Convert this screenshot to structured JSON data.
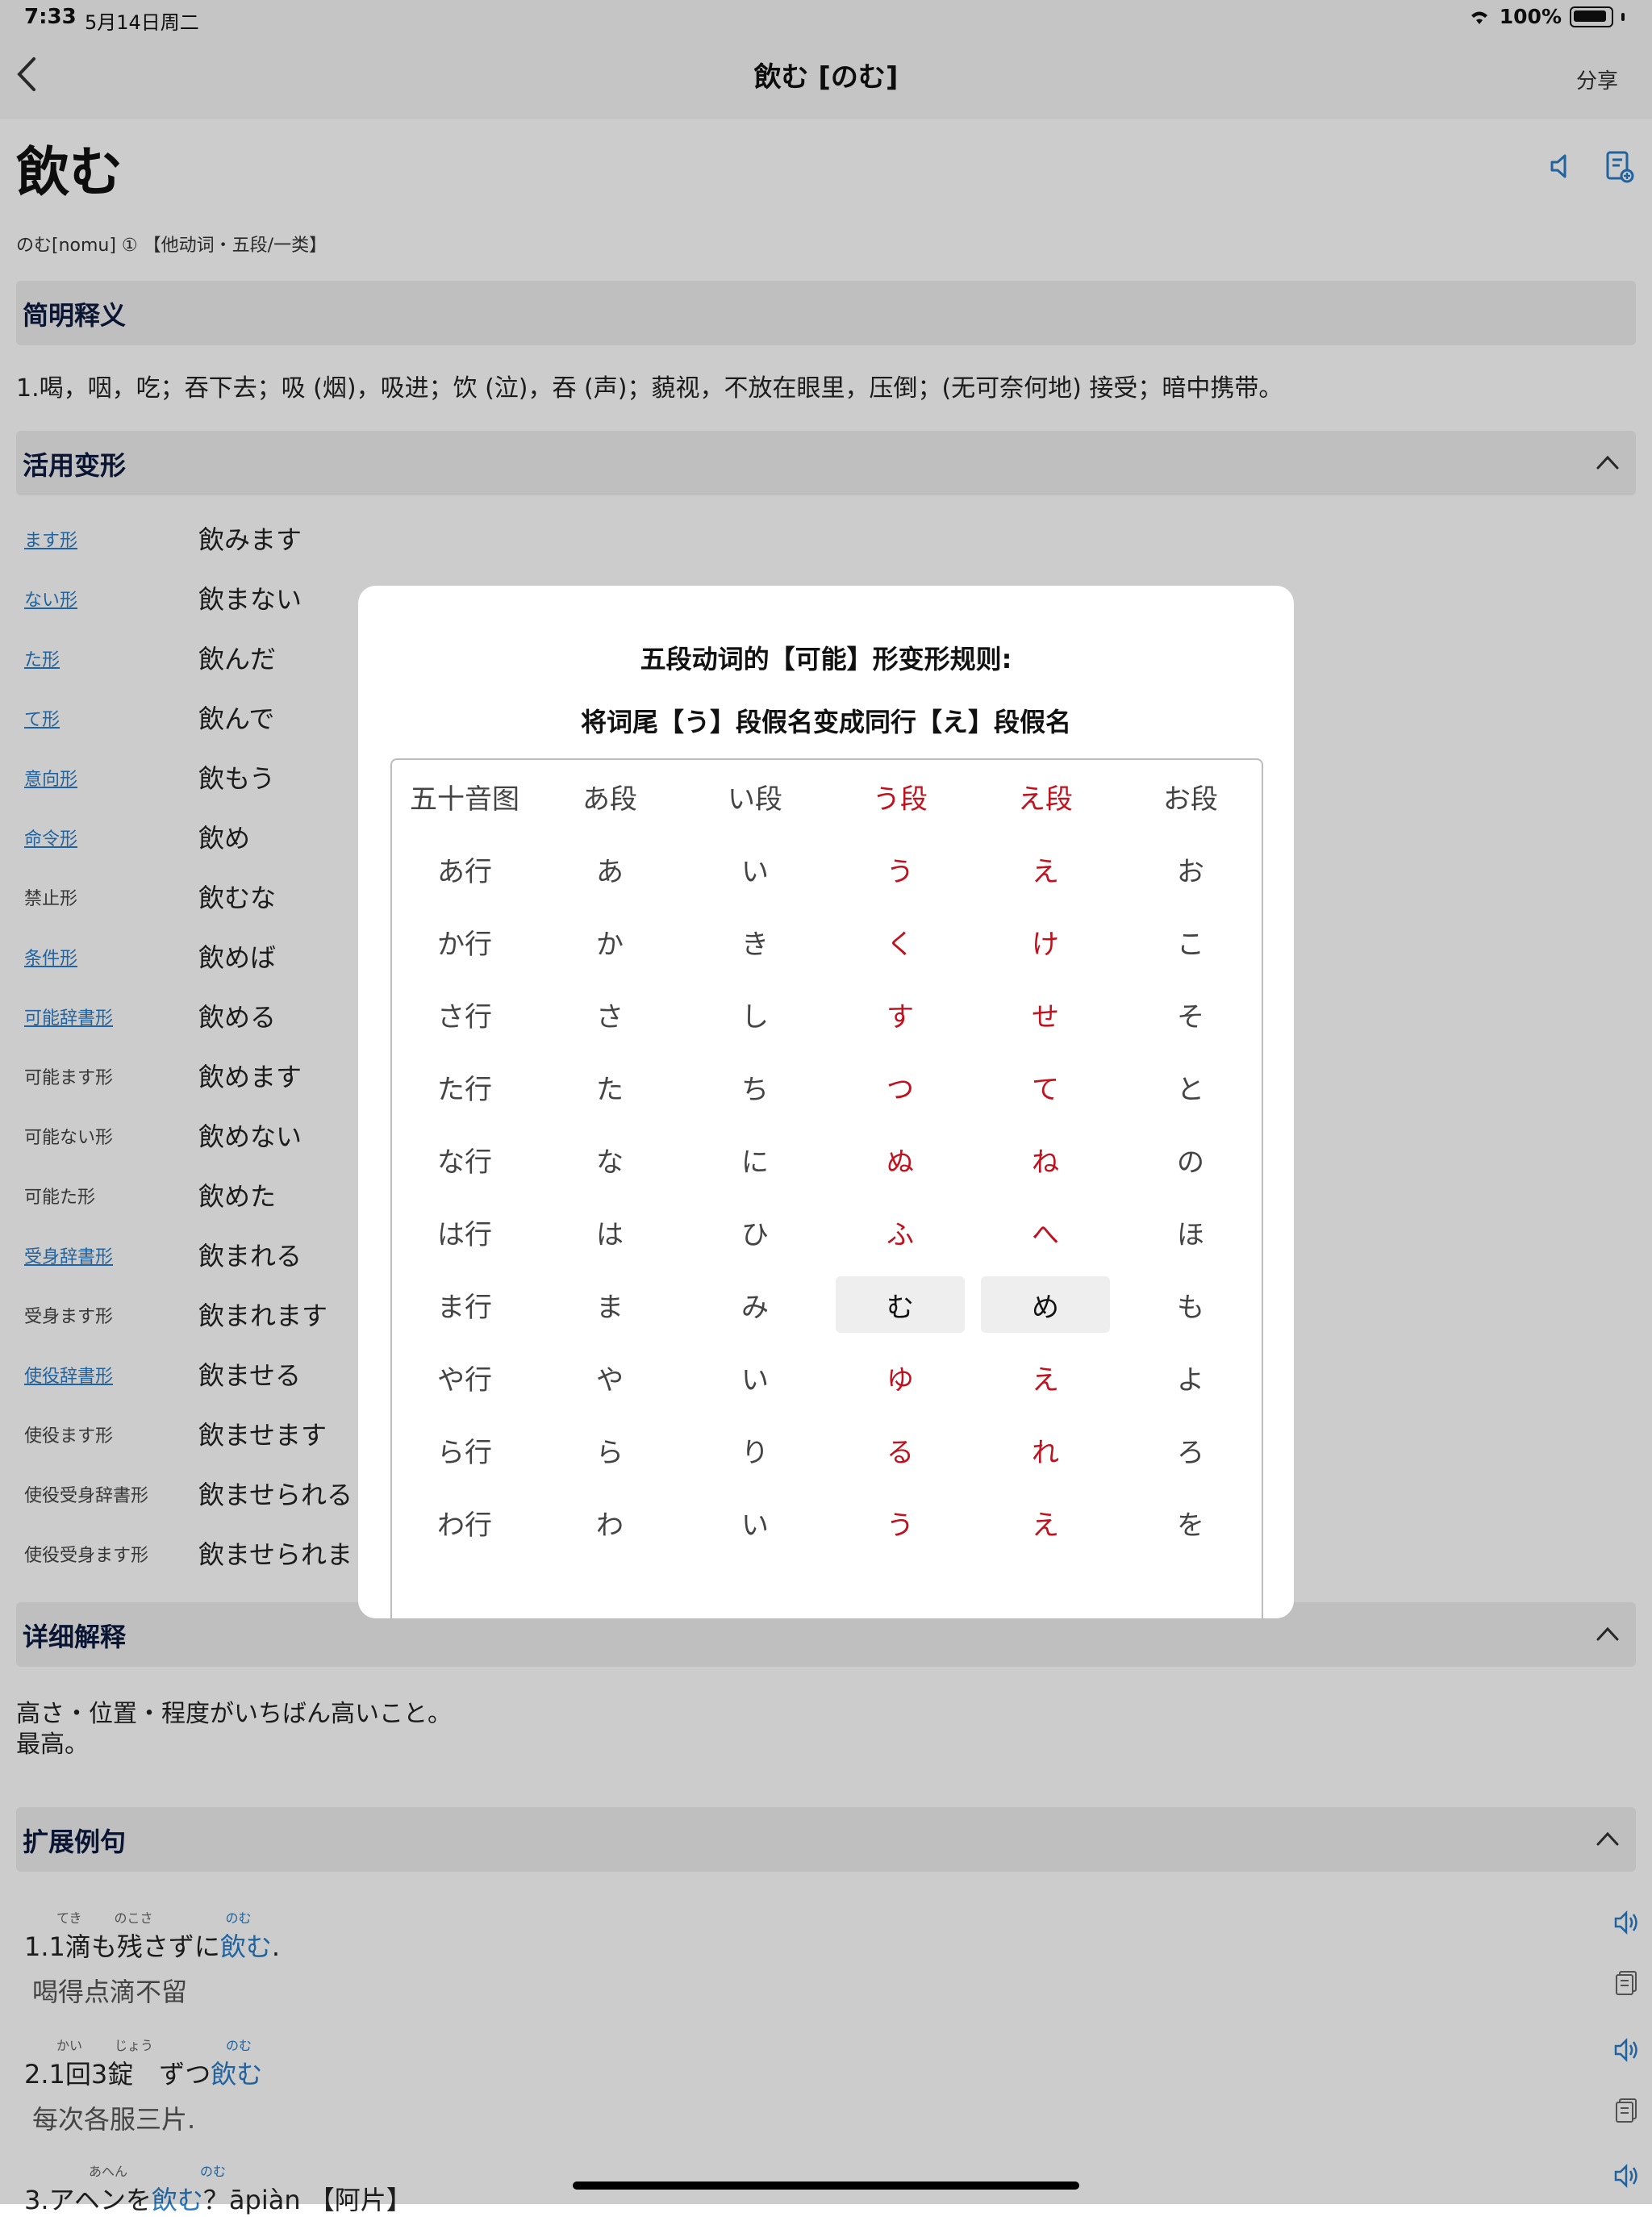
{
  "status_bar": {
    "time": "7:33",
    "date": "5月14日周二",
    "battery": "100%"
  },
  "nav": {
    "title": "飲む [のむ]",
    "share": "分享"
  },
  "word": {
    "headword": "飲む",
    "reading": "のむ[nomu] ① 【他动词・五段/一类】"
  },
  "sections": {
    "brief": {
      "title": "简明释义",
      "text": "1.喝，咽，吃；吞下去；吸 (烟)，吸进；饮 (泣)，吞 (声)；藐视，不放在眼里，压倒；(无可奈何地) 接受；暗中携带。"
    },
    "conjugation": {
      "title": "活用变形"
    },
    "detail": {
      "title": "详细解释",
      "line1": "高さ・位置・程度がいちばん高いこと。",
      "line2": "最高。"
    },
    "examples": {
      "title": "扩展例句"
    }
  },
  "conjugations": [
    {
      "label": "ます形",
      "value": "飲みます",
      "link": true
    },
    {
      "label": "ない形",
      "value": "飲まない",
      "link": true
    },
    {
      "label": "た形",
      "value": "飲んだ",
      "link": true
    },
    {
      "label": "て形",
      "value": "飲んで",
      "link": true
    },
    {
      "label": "意向形",
      "value": "飲もう",
      "link": true
    },
    {
      "label": "命令形",
      "value": "飲め",
      "link": true
    },
    {
      "label": "禁止形",
      "value": "飲むな",
      "link": false
    },
    {
      "label": "条件形",
      "value": "飲めば",
      "link": true
    },
    {
      "label": "可能辞書形",
      "value": "飲める",
      "link": true
    },
    {
      "label": "可能ます形",
      "value": "飲めます",
      "link": false
    },
    {
      "label": "可能ない形",
      "value": "飲めない",
      "link": false
    },
    {
      "label": "可能た形",
      "value": "飲めた",
      "link": false
    },
    {
      "label": "受身辞書形",
      "value": "飲まれる",
      "link": true
    },
    {
      "label": "受身ます形",
      "value": "飲まれます",
      "link": false
    },
    {
      "label": "使役辞書形",
      "value": "飲ませる",
      "link": true
    },
    {
      "label": "使役ます形",
      "value": "飲ませます",
      "link": false
    },
    {
      "label": "使役受身辞書形",
      "value": "飲ませられる",
      "link": false
    },
    {
      "label": "使役受身ます形",
      "value": "飲ませられま",
      "link": false
    }
  ],
  "examples": [
    {
      "pre": "1.1滴も残さずに",
      "verb": "飲む",
      "post": ".",
      "ruby": {
        "a": "てき",
        "b": "のこさ",
        "v": "のむ"
      },
      "translation": "喝得点滴不留"
    },
    {
      "pre": "2.1回3錠　ずつ",
      "verb": "飲む",
      "post": "",
      "ruby": {
        "a": "かい",
        "b": "じょう",
        "v": "のむ"
      },
      "translation": "每次各服三片."
    },
    {
      "pre": "3.アヘンを",
      "verb": "飲む",
      "post": "？āpiàn 【阿片】",
      "ruby": {
        "a": "",
        "b": "あへん",
        "v": "のむ"
      },
      "translation": ""
    }
  ],
  "modal": {
    "title1": "五段动词的【可能】形变形规则:",
    "title2": "将词尾【う】段假名变成同行【え】段假名",
    "header": [
      "五十音图",
      "あ段",
      "い段",
      "う段",
      "え段",
      "お段"
    ],
    "rows": [
      [
        "あ行",
        "あ",
        "い",
        "う",
        "え",
        "お"
      ],
      [
        "か行",
        "か",
        "き",
        "く",
        "け",
        "こ"
      ],
      [
        "さ行",
        "さ",
        "し",
        "す",
        "せ",
        "そ"
      ],
      [
        "た行",
        "た",
        "ち",
        "つ",
        "て",
        "と"
      ],
      [
        "な行",
        "な",
        "に",
        "ぬ",
        "ね",
        "の"
      ],
      [
        "は行",
        "は",
        "ひ",
        "ふ",
        "へ",
        "ほ"
      ],
      [
        "ま行",
        "ま",
        "み",
        "む",
        "め",
        "も"
      ],
      [
        "や行",
        "や",
        "い",
        "ゆ",
        "え",
        "よ"
      ],
      [
        "ら行",
        "ら",
        "り",
        "る",
        "れ",
        "ろ"
      ],
      [
        "わ行",
        "わ",
        "い",
        "う",
        "え",
        "を"
      ]
    ],
    "highlight_row": 6
  },
  "colors": {
    "accent_blue": "#2a7cc7",
    "kana_red": "#c0121e",
    "section_bg": "#efefef"
  }
}
